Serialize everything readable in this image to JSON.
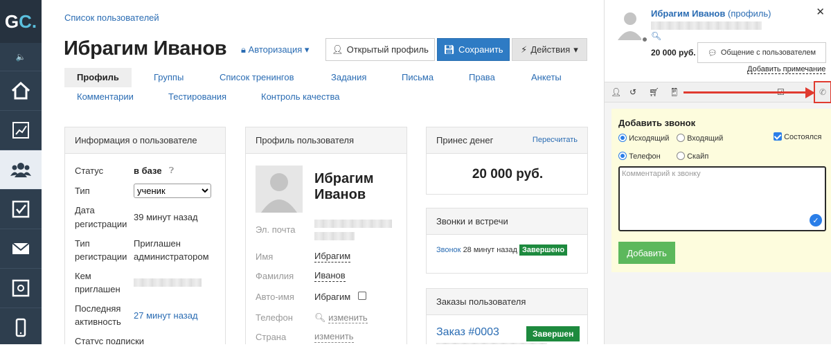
{
  "logo": {
    "g": "G",
    "c": "C."
  },
  "sidebar": {
    "icons": [
      "home-icon",
      "chart-icon",
      "users-icon",
      "checkbox-icon",
      "mail-icon",
      "safe-icon",
      "phone-icon"
    ]
  },
  "breadcrumb": "Список пользователей",
  "user_title": "Ибрагим Иванов",
  "auth_link": "Авторизация",
  "buttons": {
    "open_profile": "Открытый профиль",
    "save": "Сохранить",
    "actions": "Действия"
  },
  "tabs": [
    "Профиль",
    "Группы",
    "Список тренингов",
    "Задания",
    "Письма",
    "Права",
    "Анкеты",
    "Комментарии",
    "Тестирования",
    "Контроль качества"
  ],
  "info": {
    "title": "Информация о пользователе",
    "status_label": "Статус",
    "status_value": "в базе",
    "type_label": "Тип",
    "type_value": "ученик",
    "reg_date_label1": "Дата",
    "reg_date_label2": "регистрации",
    "reg_date_value": "39 минут назад",
    "reg_type_label1": "Тип",
    "reg_type_label2": "регистрации",
    "reg_type_value1": "Приглашен",
    "reg_type_value2": "администратором",
    "invited_label1": "Кем",
    "invited_label2": "приглашен",
    "last_label1": "Последняя",
    "last_label2": "активность",
    "last_value": "27 минут назад",
    "sub_label": "Статус подписки"
  },
  "profile": {
    "title": "Профиль пользователя",
    "name1": "Ибрагим",
    "name2": "Иванов",
    "email_label": "Эл. почта",
    "first_label": "Имя",
    "first_value": "Ибрагим",
    "last_label": "Фамилия",
    "last_value": "Иванов",
    "auto_label": "Авто-имя",
    "auto_value": "Ибрагим",
    "phone_label": "Телефон",
    "phone_value": "изменить",
    "country_label": "Страна",
    "country_value": "изменить"
  },
  "money": {
    "title": "Принес денег",
    "recalc": "Пересчитать",
    "amount": "20 000 руб."
  },
  "calls": {
    "title": "Звонки и встречи",
    "item_link": "Звонок",
    "item_time": "28 минут назад",
    "item_status": "Завершено"
  },
  "orders": {
    "title": "Заказы пользователя",
    "order": "Заказ #0003",
    "status": "Завершен"
  },
  "right": {
    "name": "Ибрагим Иванов",
    "profile_link": "(профиль)",
    "amount": "20 000 руб.",
    "chat_btn": "Общение с пользователем",
    "note": "Добавить примечание",
    "call": {
      "title": "Добавить звонок",
      "outgoing": "Исходящий",
      "incoming": "Входящий",
      "done": "Состоялся",
      "phone": "Телефон",
      "skype": "Скайп",
      "placeholder": "Комментарий к звонку",
      "add": "Добавить"
    }
  },
  "colors": {
    "link": "#2a6cb3",
    "primary": "#2e7bc4",
    "success": "#1d8a3e",
    "sidebar": "#2e3e4e",
    "arrow": "#e03a2f"
  }
}
